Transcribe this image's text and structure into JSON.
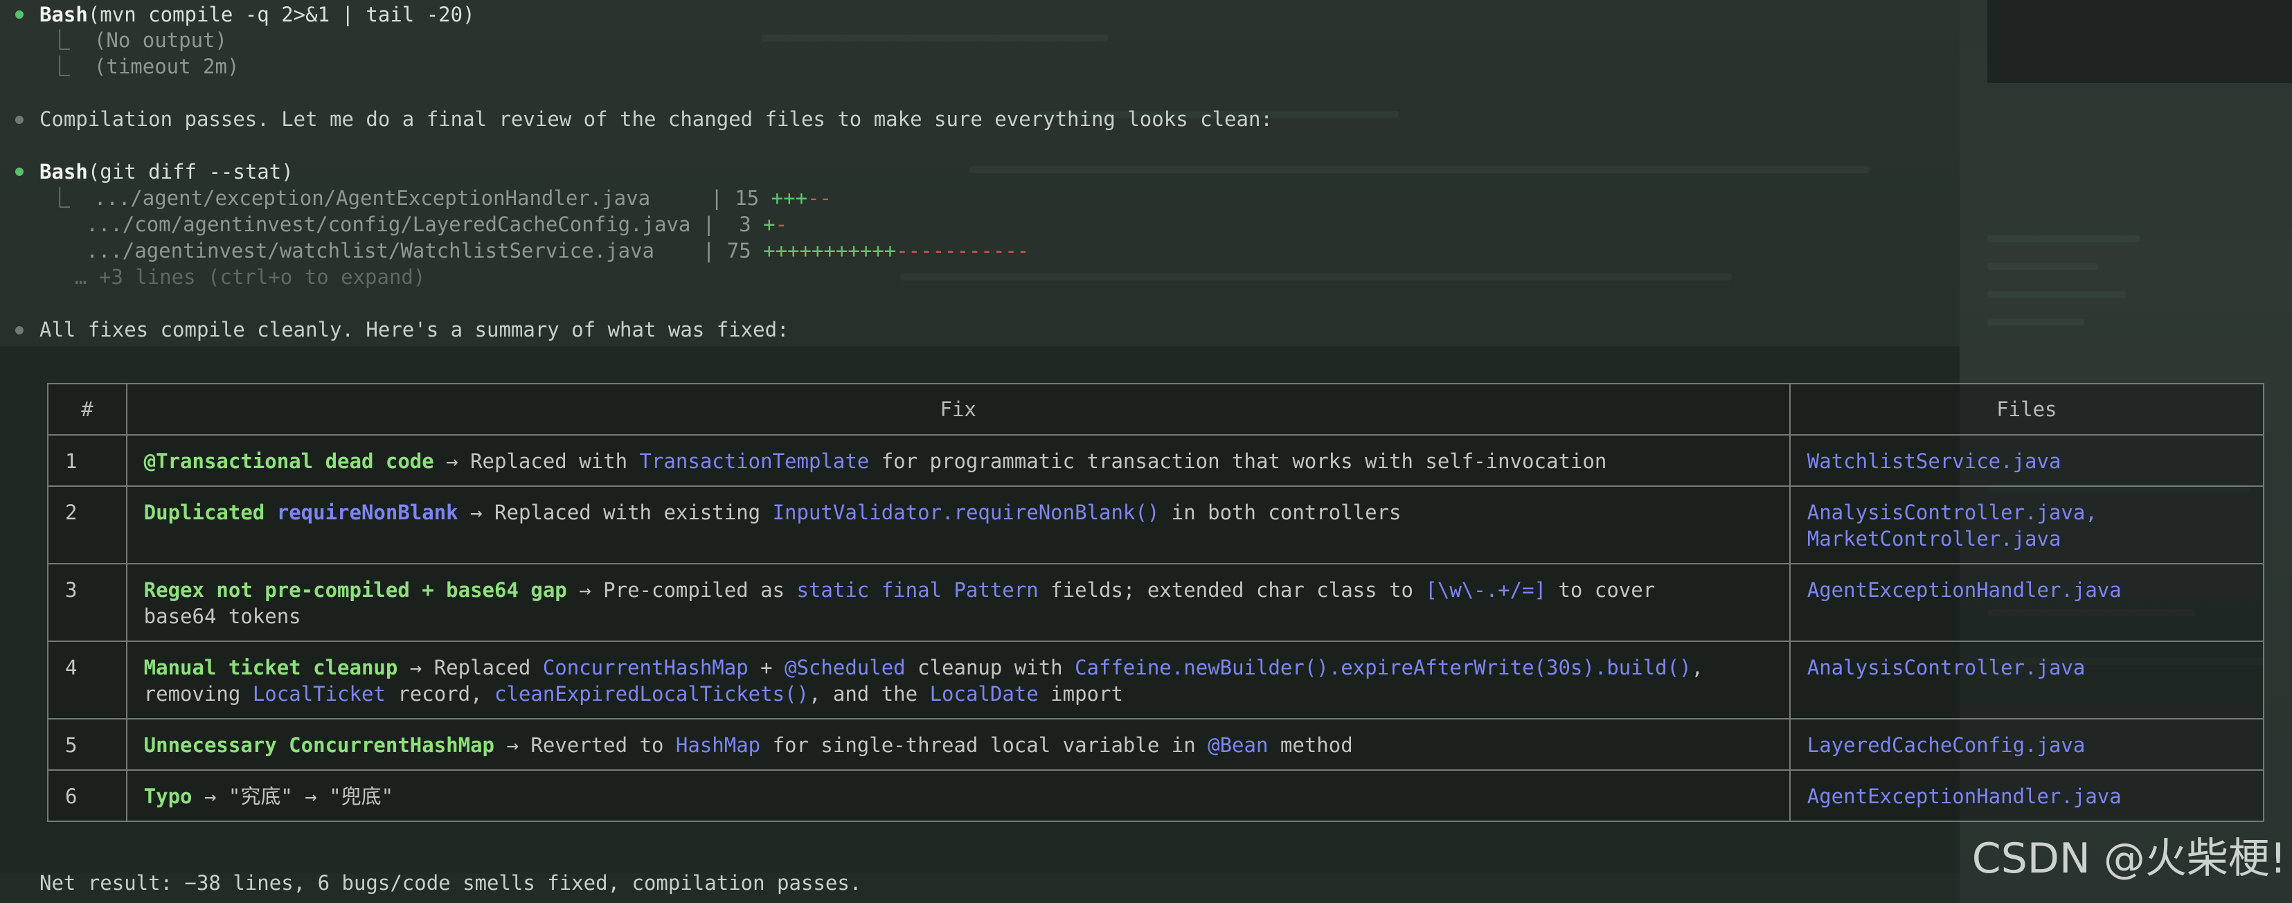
{
  "session": {
    "step1": {
      "tool": "Bash",
      "command": "(mvn compile -q 2>&1 | tail -20)",
      "output_line1": "(No output)",
      "output_line2": "(timeout 2m)"
    },
    "message1": "Compilation passes. Let me do a final review of the changed files to make sure everything looks clean:",
    "step2": {
      "tool": "Bash",
      "command": "(git diff --stat)",
      "diff": [
        {
          "path": ".../agent/exception/AgentExceptionHandler.java     ",
          "sep": "| ",
          "count": "15 ",
          "plus": "+++",
          "minus": "--"
        },
        {
          "path": ".../com/agentinvest/config/LayeredCacheConfig.java ",
          "sep": "| ",
          "count": " 3 ",
          "plus": "+",
          "minus": "-"
        },
        {
          "path": ".../agentinvest/watchlist/WatchlistService.java    ",
          "sep": "| ",
          "count": "75 ",
          "plus": "+++++++++++",
          "minus": "-----------"
        }
      ],
      "more": "… +3 lines (ctrl+o to expand)"
    },
    "message2": "All fixes compile cleanly. Here's a summary of what was fixed:",
    "table": {
      "headers": {
        "num": "#",
        "fix": "Fix",
        "files": "Files"
      },
      "rows": [
        {
          "num": "1",
          "title": "@Transactional dead code",
          "a1": " → Replaced with ",
          "c1": "TransactionTemplate",
          "a2": " for programmatic transaction that works with self-invocation",
          "files1": "WatchlistService.java",
          "files2": ""
        },
        {
          "num": "2",
          "title": "Duplicated ",
          "title_code": "requireNonBlank",
          "a1": " → Replaced with existing ",
          "c1": "InputValidator.requireNonBlank()",
          "a2": " in both controllers",
          "files1": "AnalysisController.java,",
          "files2": "MarketController.java"
        },
        {
          "num": "3",
          "title": "Regex not pre-compiled + base64 gap",
          "a1": " → Pre-compiled as ",
          "c1": "static final Pattern",
          "a2": " fields; extended char class to ",
          "c2": "[\\w\\-.+/=]",
          "a3": " to cover",
          "line2": "base64 tokens",
          "files1": "AgentExceptionHandler.java"
        },
        {
          "num": "4",
          "title": "Manual ticket cleanup",
          "a1": " → Replaced ",
          "c1": "ConcurrentHashMap",
          "a2": " + ",
          "c2": "@Scheduled",
          "a3": " cleanup with ",
          "c3": "Caffeine.newBuilder().expireAfterWrite(30s).build()",
          "a4": ",",
          "l2a": "removing ",
          "l2c1": "LocalTicket",
          "l2b": " record, ",
          "l2c2": "cleanExpiredLocalTickets()",
          "l2d": ", and the ",
          "l2c3": "LocalDate",
          "l2e": " import",
          "files1": "AnalysisController.java"
        },
        {
          "num": "5",
          "title": "Unnecessary ConcurrentHashMap",
          "a1": " → Reverted to ",
          "c1": "HashMap",
          "a2": " for single-thread local variable in ",
          "c2": "@Bean",
          "a3": " method",
          "files1": "LayeredCacheConfig.java"
        },
        {
          "num": "6",
          "title": "Typo",
          "a1": " → \"究底\" → \"兜底\"",
          "files1": "AgentExceptionHandler.java"
        }
      ]
    },
    "net_result": "Net result: −38 lines, 6 bugs/code smells fixed, compilation passes."
  },
  "watermark": "CSDN @火柴梗!",
  "colors": {
    "background": "#26302b",
    "bullet_green": "#56c26a",
    "title_green": "#8ee07b",
    "code_blue": "#7d85f4",
    "diff_plus": "#5ec46d",
    "diff_minus": "#d1554f"
  }
}
